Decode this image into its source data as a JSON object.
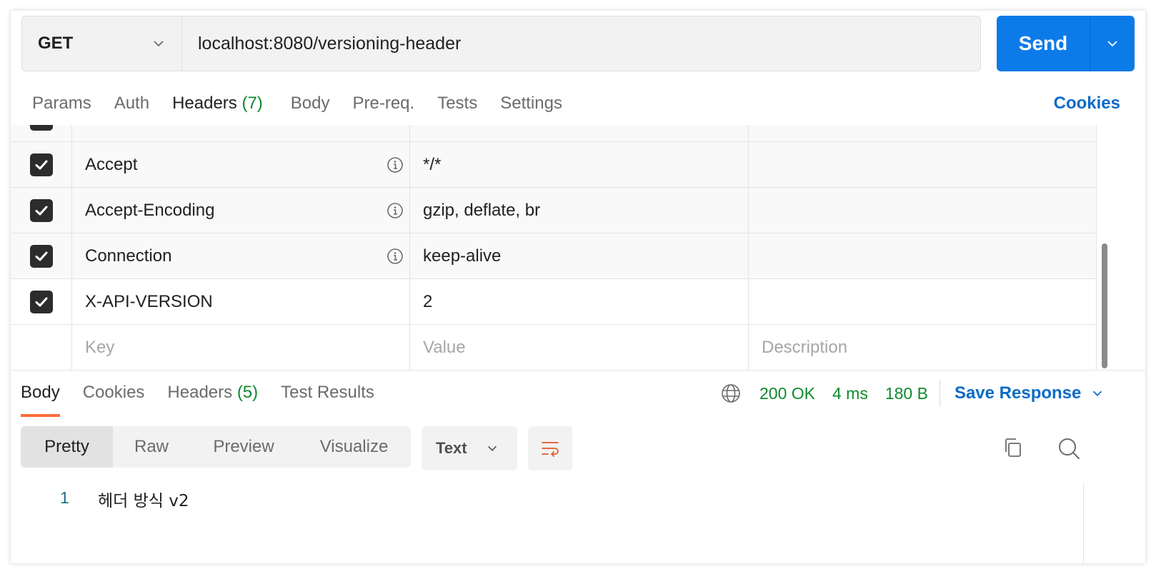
{
  "request": {
    "method": "GET",
    "url": "localhost:8080/versioning-header",
    "send_label": "Send"
  },
  "request_tabs": [
    {
      "label": "Params",
      "count": ""
    },
    {
      "label": "Auth",
      "count": ""
    },
    {
      "label": "Headers",
      "count": "(7)"
    },
    {
      "label": "Body",
      "count": ""
    },
    {
      "label": "Pre-req.",
      "count": ""
    },
    {
      "label": "Tests",
      "count": ""
    },
    {
      "label": "Settings",
      "count": ""
    }
  ],
  "cookies_label": "Cookies",
  "headers": [
    {
      "key": "Accept",
      "value": "*/*",
      "description": "",
      "checked": true,
      "info": true
    },
    {
      "key": "Accept-Encoding",
      "value": "gzip, deflate, br",
      "description": "",
      "checked": true,
      "info": true
    },
    {
      "key": "Connection",
      "value": "keep-alive",
      "description": "",
      "checked": true,
      "info": true
    },
    {
      "key": "X-API-VERSION",
      "value": "2",
      "description": "",
      "checked": true,
      "info": false
    }
  ],
  "new_row": {
    "key_placeholder": "Key",
    "value_placeholder": "Value",
    "description_placeholder": "Description"
  },
  "response": {
    "tabs": [
      {
        "label": "Body",
        "count": ""
      },
      {
        "label": "Cookies",
        "count": ""
      },
      {
        "label": "Headers",
        "count": "(5)"
      },
      {
        "label": "Test Results",
        "count": ""
      }
    ],
    "status": "200 OK",
    "time": "4 ms",
    "size": "180 B",
    "save_label": "Save Response",
    "view_modes": [
      "Pretty",
      "Raw",
      "Preview",
      "Visualize"
    ],
    "format": "Text",
    "body_lines": [
      {
        "number": "1",
        "text": "헤더 방식 v2"
      }
    ]
  },
  "colors": {
    "accent": "#ff6c37",
    "primary": "#0c7be8",
    "success": "#0f8a2e",
    "link": "#0a6bc8"
  },
  "icons": [
    "chevron-down-icon",
    "check-icon",
    "info-icon",
    "globe-icon",
    "wrap-lines-icon",
    "copy-icon",
    "search-icon"
  ]
}
